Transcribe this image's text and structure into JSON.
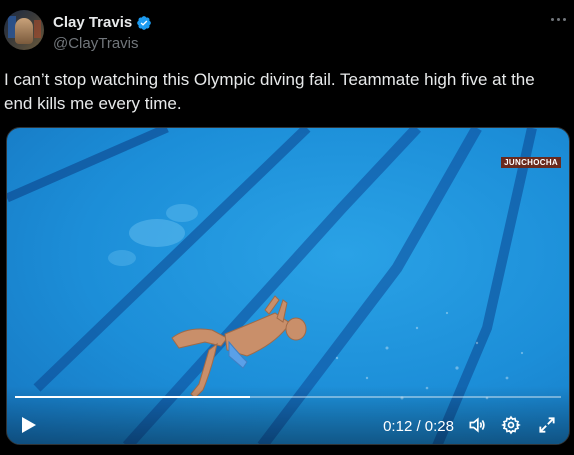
{
  "author": {
    "display_name": "Clay Travis",
    "handle": "@ClayTravis",
    "verified": true
  },
  "tweet": {
    "text": "I can’t stop watching this Olympic diving fail. Teammate high five at the end kills me every time."
  },
  "video": {
    "watermark": "JUNCHOCHA",
    "current_time": "0:12",
    "duration": "0:28",
    "time_display": "0:12 / 0:28",
    "progress_fraction": 0.43
  },
  "icons": {
    "more": "more-options-icon",
    "verified": "verified-badge-icon",
    "play": "play-icon",
    "volume": "volume-icon",
    "settings": "gear-icon",
    "fullscreen": "fullscreen-icon"
  },
  "colors": {
    "background": "#000000",
    "text": "#e7e9ea",
    "secondary_text": "#71767b",
    "verified_blue": "#1d9bf0",
    "pool_water": "#1c8ed8"
  }
}
